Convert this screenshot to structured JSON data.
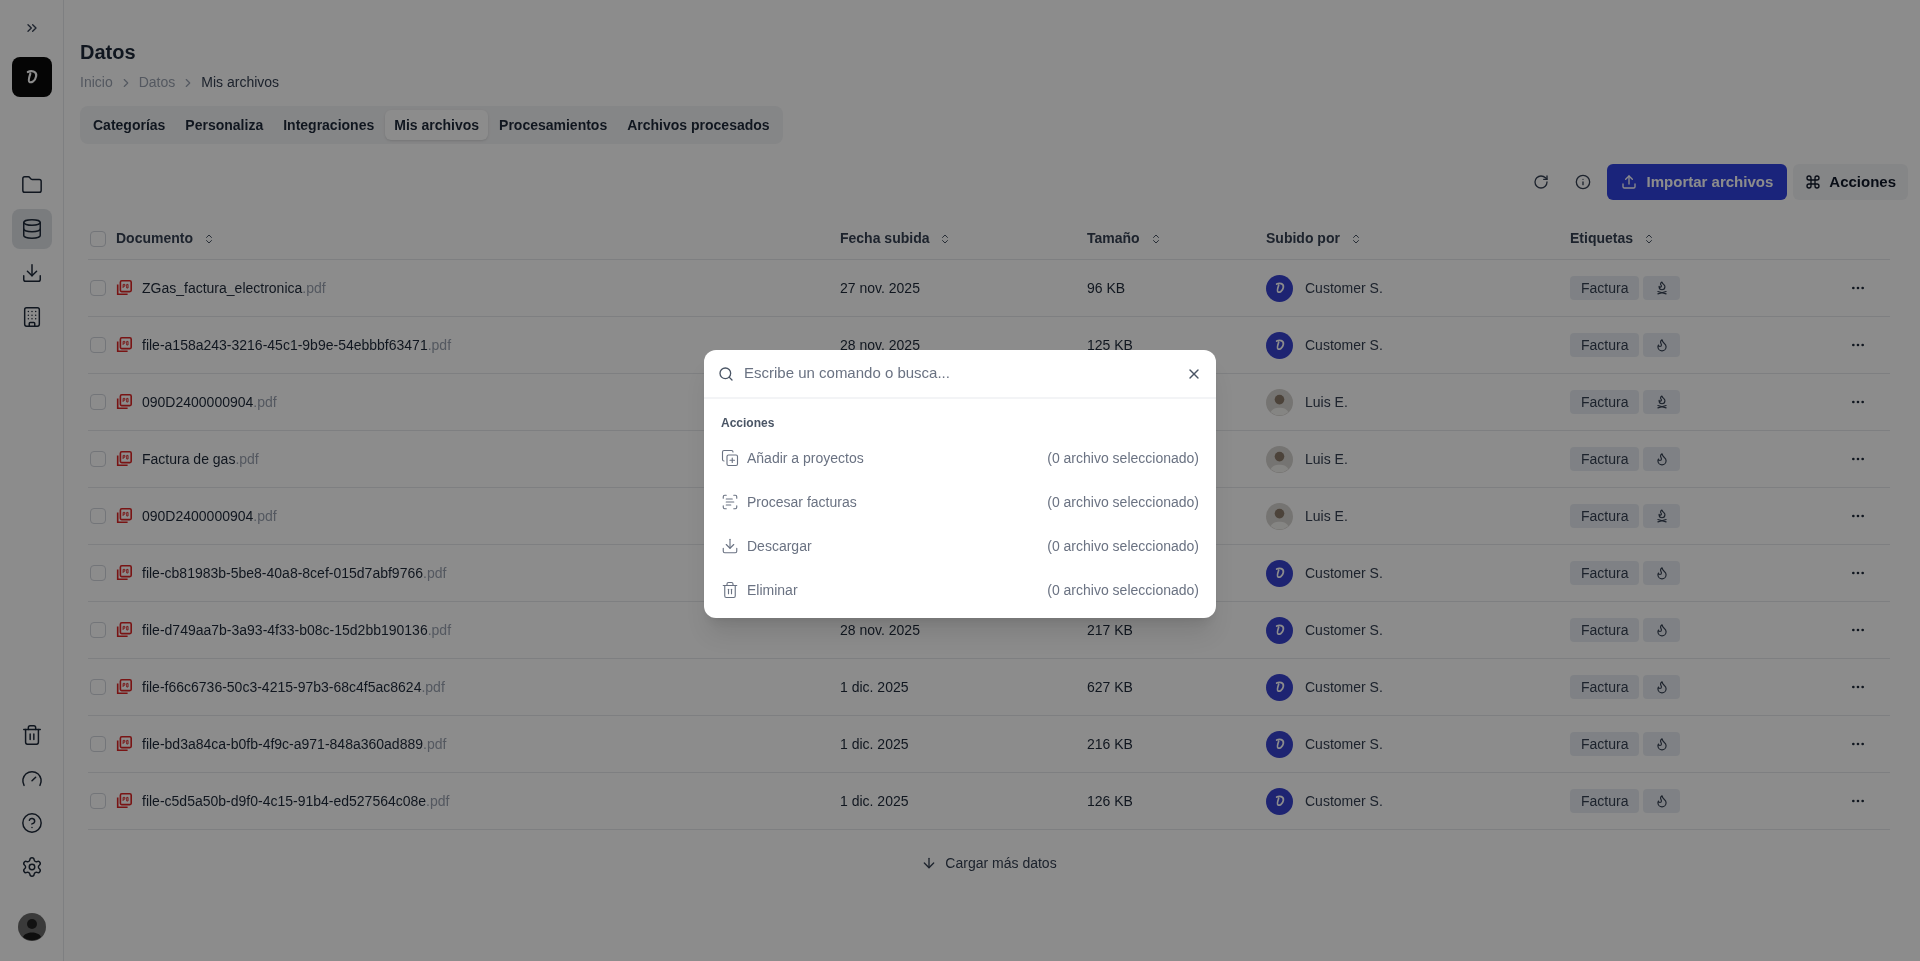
{
  "sidebar": {
    "items": [
      {
        "selected": false
      },
      {
        "selected": true
      },
      {
        "selected": false
      },
      {
        "selected": false
      }
    ]
  },
  "page": {
    "title": "Datos",
    "breadcrumb": [
      "Inicio",
      "Datos",
      "Mis archivos"
    ]
  },
  "tabs": [
    {
      "label": "Categorías",
      "selected": false
    },
    {
      "label": "Personaliza",
      "selected": false
    },
    {
      "label": "Integraciones",
      "selected": false
    },
    {
      "label": "Mis archivos",
      "selected": true
    },
    {
      "label": "Procesamientos",
      "selected": false
    },
    {
      "label": "Archivos procesados",
      "selected": false
    }
  ],
  "toolbar": {
    "import_button": "Importar archivos",
    "actions_button": "Acciones"
  },
  "table": {
    "header_checked": false,
    "columns": [
      "Documento",
      "Fecha subida",
      "Tamaño",
      "Subido por",
      "Etiquetas"
    ],
    "rows": [
      {
        "name": "ZGas_factura_electronica.pdf",
        "date": "27 nov. 2025",
        "size": "96 KB",
        "uploader": "Customer S.",
        "avatar": {
          "kind": "logo"
        },
        "tag": "Factura",
        "tag_icon": {
          "kind": "campfire"
        },
        "checked": false
      },
      {
        "name": "file-a158a243-3216-45c1-9b9e-54ebbbf63471.pdf",
        "date": "28 nov. 2025",
        "size": "125 KB",
        "uploader": "Customer S.",
        "avatar": {
          "kind": "logo"
        },
        "tag": "Factura",
        "tag_icon": {
          "kind": "flame"
        },
        "checked": false
      },
      {
        "name": "090D2400000904.pdf",
        "uploader": "Luis E.",
        "avatar": {
          "kind": "photo"
        },
        "tag": "Factura",
        "tag_icon": {
          "kind": "campfire"
        },
        "checked": false
      },
      {
        "name": "Factura de gas.pdf",
        "uploader": "Luis E.",
        "avatar": {
          "kind": "photo"
        },
        "tag": "Factura",
        "tag_icon": {
          "kind": "flame"
        },
        "checked": false
      },
      {
        "name": "090D2400000904.pdf",
        "uploader": "Luis E.",
        "avatar": {
          "kind": "photo"
        },
        "tag": "Factura",
        "tag_icon": {
          "kind": "campfire"
        },
        "checked": false
      },
      {
        "name": "file-cb81983b-5be8-40a8-8cef-015d7abf9766.pdf",
        "uploader": "Customer S.",
        "avatar": {
          "kind": "logo"
        },
        "tag": "Factura",
        "tag_icon": {
          "kind": "flame"
        },
        "checked": false
      },
      {
        "name": "file-d749aa7b-3a93-4f33-b08c-15d2bb190136.pdf",
        "date": "28 nov. 2025",
        "size": "217 KB",
        "uploader": "Customer S.",
        "avatar": {
          "kind": "logo"
        },
        "tag": "Factura",
        "tag_icon": {
          "kind": "flame"
        },
        "checked": false
      },
      {
        "name": "file-f66c6736-50c3-4215-97b3-68c4f5ac8624.pdf",
        "date": "1 dic. 2025",
        "size": "627 KB",
        "uploader": "Customer S.",
        "avatar": {
          "kind": "logo"
        },
        "tag": "Factura",
        "tag_icon": {
          "kind": "flame"
        },
        "checked": false
      },
      {
        "name": "file-bd3a84ca-b0fb-4f9c-a971-848a360ad889.pdf",
        "date": "1 dic. 2025",
        "size": "216 KB",
        "uploader": "Customer S.",
        "avatar": {
          "kind": "logo"
        },
        "tag": "Factura",
        "tag_icon": {
          "kind": "flame"
        },
        "checked": false
      },
      {
        "name": "file-c5d5a50b-d9f0-4c15-91b4-ed527564c08e.pdf",
        "date": "1 dic. 2025",
        "size": "126 KB",
        "uploader": "Customer S.",
        "avatar": {
          "kind": "logo"
        },
        "tag": "Factura",
        "tag_icon": {
          "kind": "flame"
        },
        "checked": false
      }
    ]
  },
  "load_more": "Cargar más datos",
  "command_palette": {
    "placeholder": "Escribe un comando o busca...",
    "group": "Acciones",
    "items": [
      {
        "label": "Añadir a proyectos",
        "hint": "(0 archivo seleccionado)",
        "disabled": true
      },
      {
        "label": "Procesar facturas",
        "hint": "(0 archivo seleccionado)",
        "disabled": true
      },
      {
        "label": "Descargar",
        "hint": "(0 archivo seleccionado)",
        "disabled": true
      },
      {
        "label": "Eliminar",
        "hint": "(0 archivo seleccionado)",
        "disabled": true
      }
    ]
  }
}
